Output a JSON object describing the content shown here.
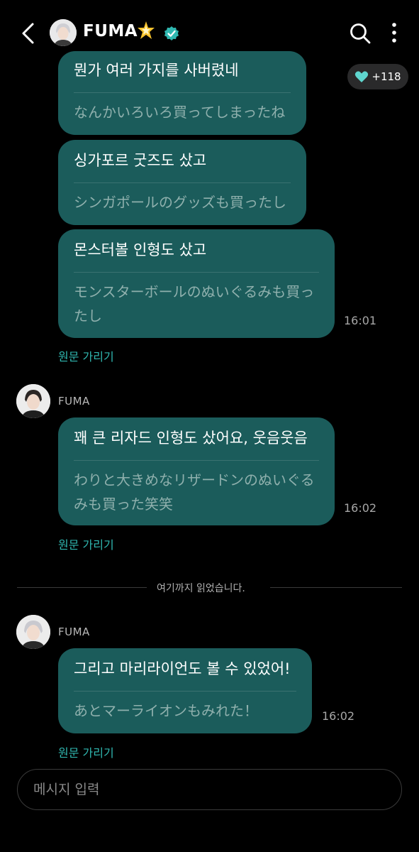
{
  "header": {
    "name": "FUMA",
    "accent": "#30b8b1"
  },
  "likes": {
    "count": "+118",
    "heart_color": "#5fd6cf"
  },
  "messages": [
    {
      "original": "뭔가 여러 가지를 사버렸네",
      "translation": "なんかいろいろ買ってしまったね"
    },
    {
      "original": "싱가포르 굿즈도 샀고",
      "translation": "シンガポールのグッズも買ったし"
    },
    {
      "original": "몬스터볼 인형도 샀고",
      "translation_line1": "モンスターボールのぬいぐるみも買っ",
      "translation_line2": "たし",
      "time": "16:01"
    }
  ],
  "hide_original_label": "원문 가리기",
  "group2": {
    "sender": "FUMA",
    "original": "꽤 큰 리자드 인형도 샀어요, 웃음웃음",
    "translation_line1": "わりと大きめなリザードンのぬいぐる",
    "translation_line2": "みも買った笑笑",
    "time": "16:02"
  },
  "divider": {
    "text": "여기까지 읽었습니다."
  },
  "group3": {
    "sender": "FUMA",
    "original": "그리고 마리라이언도 볼 수 있었어!",
    "translation": "あとマーライオンもみれた！",
    "time": "16:02"
  },
  "input": {
    "placeholder": "메시지 입력"
  },
  "colors": {
    "bubble": "#1b5c5b",
    "link": "#30b8b1",
    "background": "#000000"
  }
}
